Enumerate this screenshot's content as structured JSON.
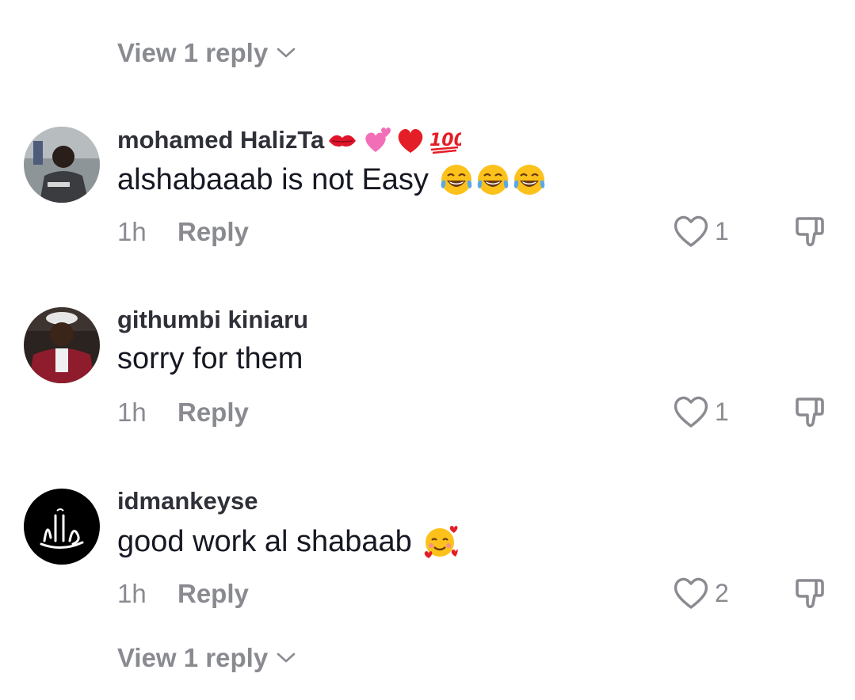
{
  "top_view_replies": {
    "label": "View 1 reply"
  },
  "comments": [
    {
      "username": "mohamed HalizTa",
      "username_emojis": [
        "kiss-mark",
        "revolving-hearts",
        "red-heart",
        "hundred-points"
      ],
      "text": "alshabaaab is not Easy",
      "text_emojis": [
        "tears-of-joy",
        "tears-of-joy",
        "tears-of-joy"
      ],
      "time": "1h",
      "reply_label": "Reply",
      "likes": "1"
    },
    {
      "username": "githumbi kiniaru",
      "username_emojis": [],
      "text": "sorry for them",
      "text_emojis": [],
      "time": "1h",
      "reply_label": "Reply",
      "likes": "1"
    },
    {
      "username": "idmankeyse",
      "username_emojis": [],
      "text": "good work al shabaab",
      "text_emojis": [
        "smiling-face-with-hearts"
      ],
      "time": "1h",
      "reply_label": "Reply",
      "likes": "2"
    }
  ],
  "bottom_view_replies": {
    "label": "View 1 reply"
  },
  "colors": {
    "muted": "#8a8b91",
    "text": "#161823"
  }
}
